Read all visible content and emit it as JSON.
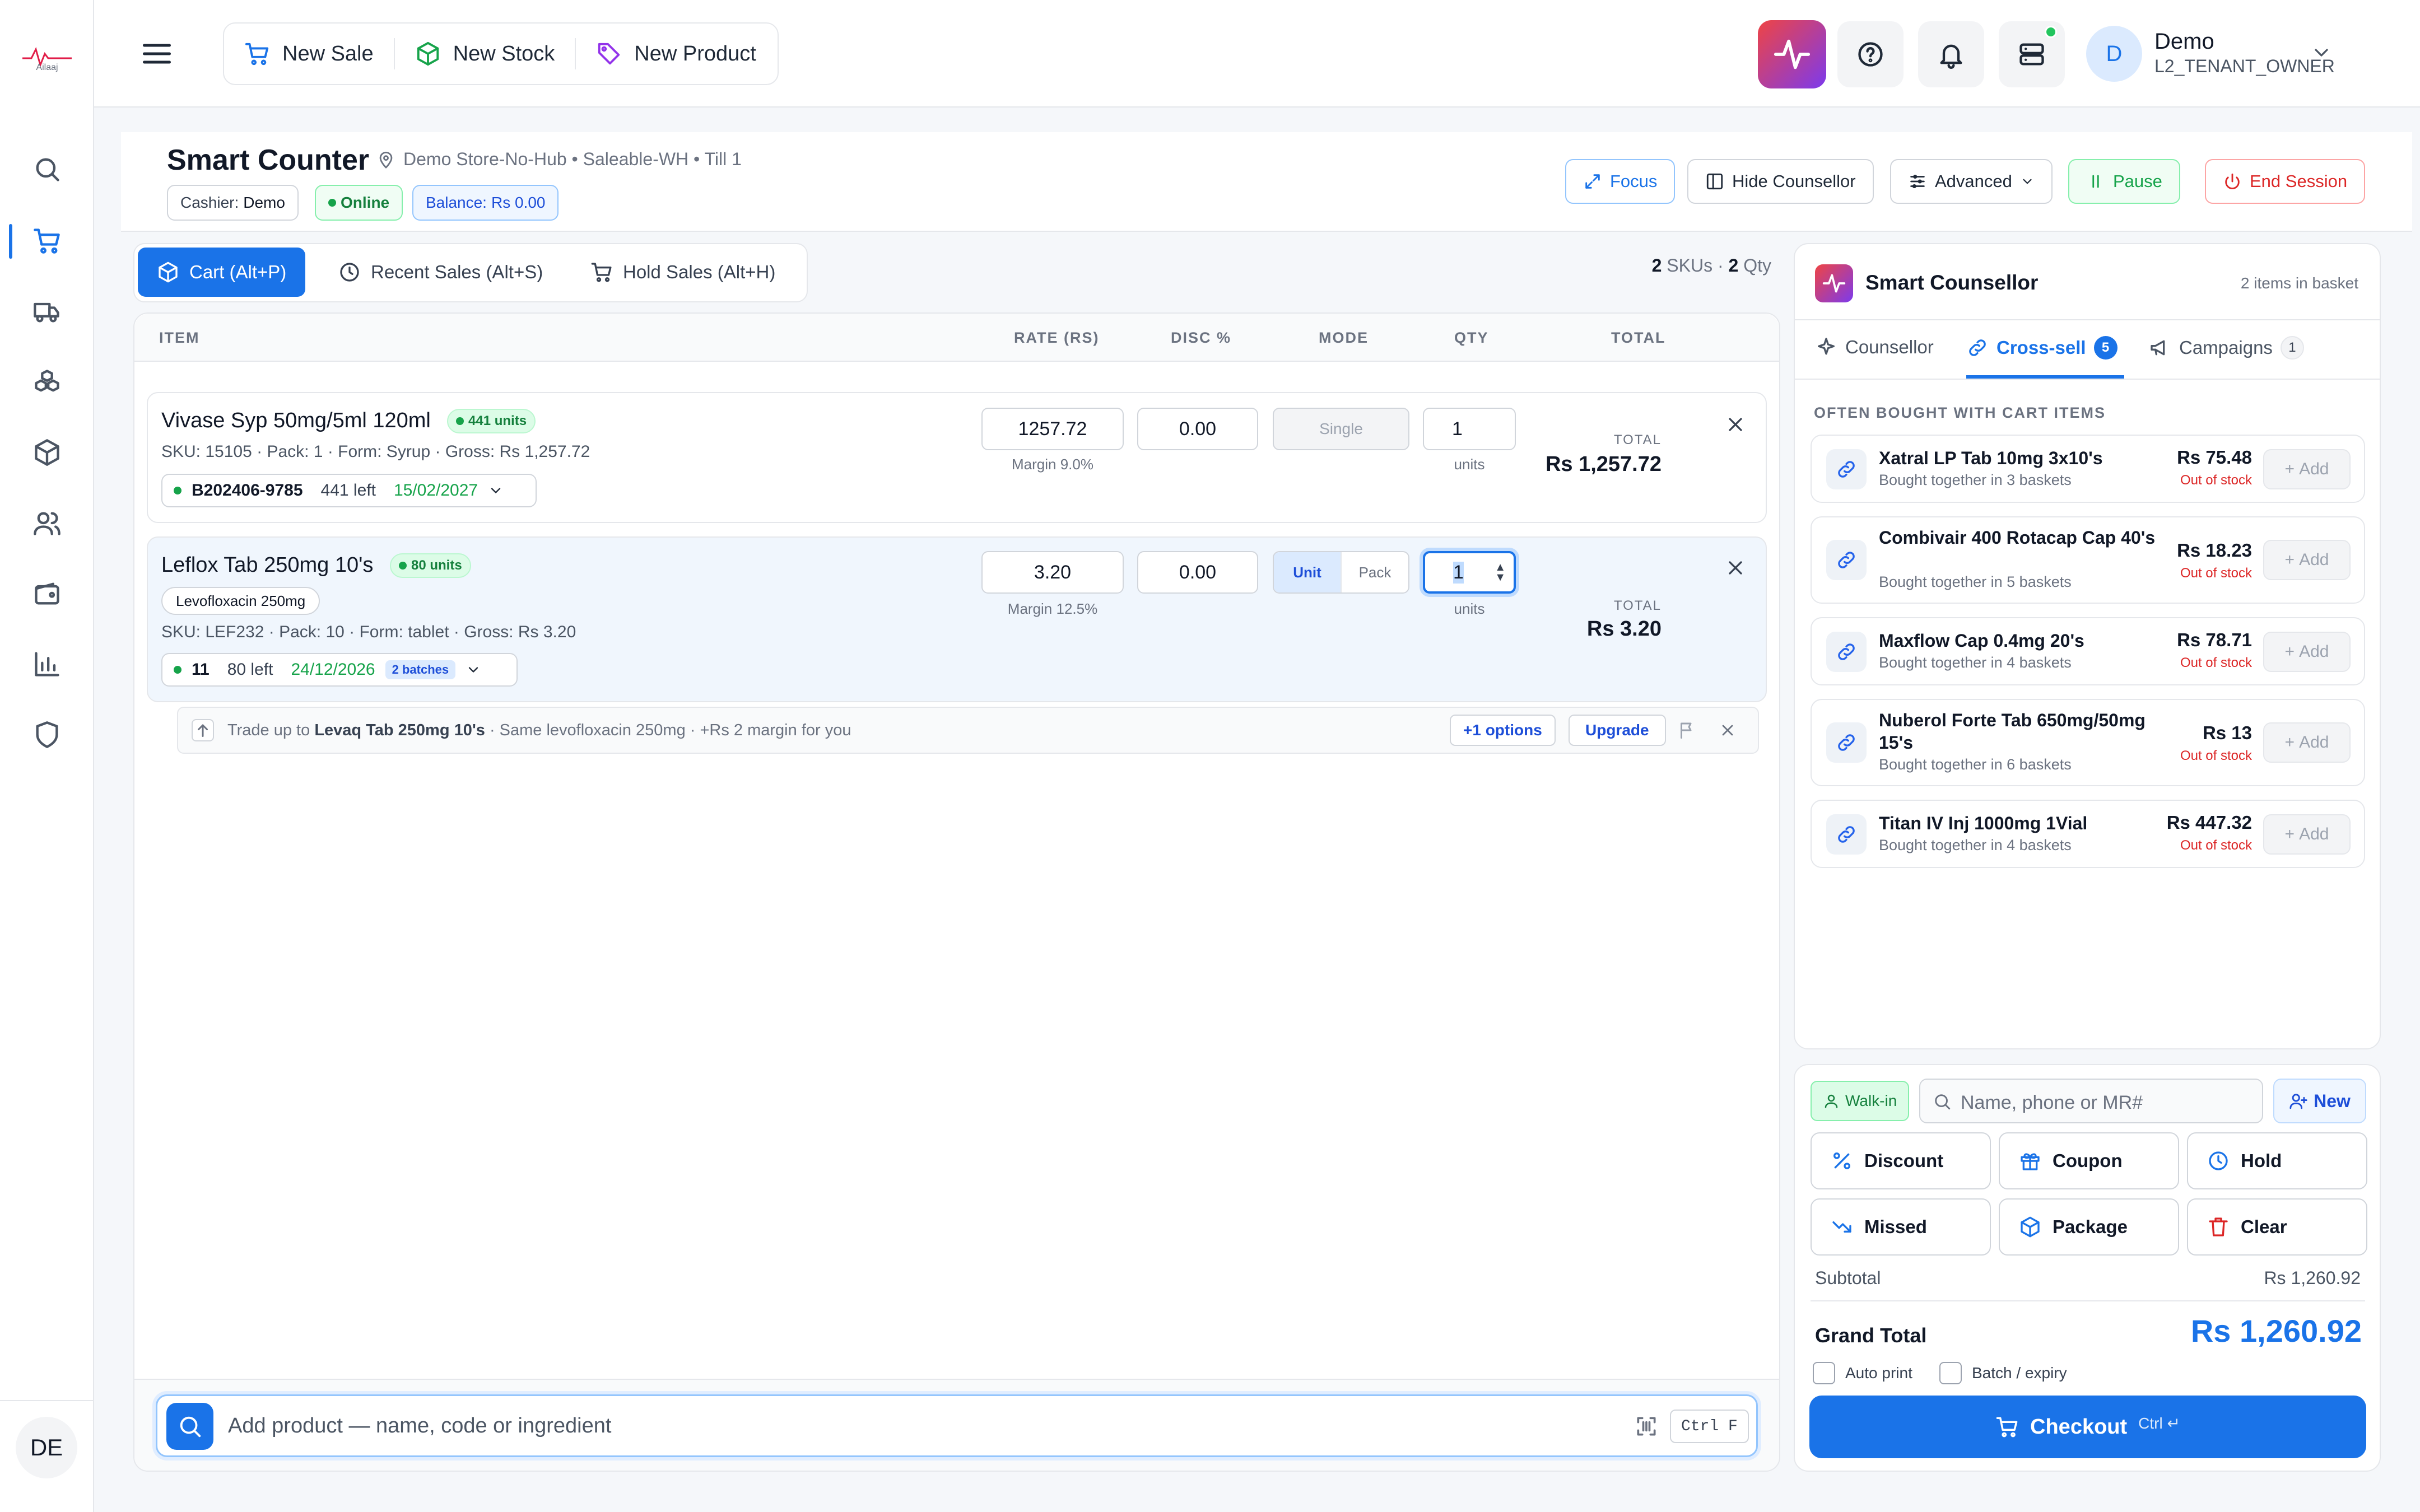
{
  "app": {
    "logo_text": "Ailaaj"
  },
  "user": {
    "avatar": "DE",
    "initial": "D",
    "name": "Demo",
    "role": "L2_TENANT_OWNER"
  },
  "quick_actions": [
    "New Sale",
    "New Stock",
    "New Product"
  ],
  "header": {
    "title": "Smart Counter",
    "location": "Demo Store-No-Hub • Saleable-WH • Till 1",
    "cashier_label": "Cashier:",
    "cashier": "Demo",
    "status": "Online",
    "balance_label": "Balance:",
    "balance": "Rs 0.00",
    "buttons": {
      "focus": "Focus",
      "hide": "Hide Counsellor",
      "advanced": "Advanced",
      "pause": "Pause",
      "end": "End Session"
    }
  },
  "tabs": [
    "Cart (Alt+P)",
    "Recent Sales (Alt+S)",
    "Hold Sales (Alt+H)"
  ],
  "summary": {
    "skus": "2",
    "skus_label": "SKUs ·",
    "qty": "2",
    "qty_label": "Qty"
  },
  "columns": [
    "ITEM",
    "RATE (RS)",
    "DISC %",
    "MODE",
    "QTY",
    "TOTAL"
  ],
  "cart": [
    {
      "name": "Vivase Syp 50mg/5ml 120ml",
      "stock_badge": "441 units",
      "meta": "SKU: 15105  ·  Pack: 1  ·  Form: Syrup  ·  Gross: Rs 1,257.72",
      "batch": "B202406-9785",
      "left": "441 left",
      "expiry": "15/02/2027",
      "rate": "1257.72",
      "margin": "Margin 9.0%",
      "disc": "0.00",
      "mode": "Single",
      "qty": "1",
      "units": "units",
      "total_label": "TOTAL",
      "total": "Rs 1,257.72"
    },
    {
      "name": "Leflox Tab 250mg 10's",
      "stock_badge": "80 units",
      "ingredient": "Levofloxacin 250mg",
      "meta": "SKU: LEF232  ·  Pack: 10  ·  Form: tablet  ·  Gross: Rs 3.20",
      "batch": "11",
      "left": "80 left",
      "expiry": "24/12/2026",
      "batches": "2 batches",
      "rate": "3.20",
      "margin": "Margin 12.5%",
      "disc": "0.00",
      "mode_a": "Unit",
      "mode_b": "Pack",
      "qty": "1",
      "units": "units",
      "total_label": "TOTAL",
      "total": "Rs 3.20"
    }
  ],
  "upsell": {
    "prefix": "Trade up to",
    "product": "Levaq Tab 250mg 10's",
    "suffix": "· Same levofloxacin 250mg · +Rs 2 margin for you",
    "options": "+1 options",
    "upgrade": "Upgrade"
  },
  "search": {
    "placeholder": "Add product — name, code or ingredient",
    "shortcut": "Ctrl F"
  },
  "counsellor": {
    "title": "Smart Counsellor",
    "basket": "2 items in basket",
    "tabs": [
      {
        "label": "Counsellor"
      },
      {
        "label": "Cross-sell",
        "count": "5"
      },
      {
        "label": "Campaigns",
        "count": "1"
      }
    ],
    "section": "OFTEN BOUGHT WITH CART ITEMS",
    "items": [
      {
        "name": "Xatral LP Tab 10mg 3x10's",
        "sub": "Bought together in 3 baskets",
        "price": "Rs 75.48",
        "status": "Out of stock",
        "add": "Add"
      },
      {
        "name": "Combivair 400 Rotacap Cap 40's",
        "sub": "Bought together in 5 baskets",
        "price": "Rs 18.23",
        "status": "Out of stock",
        "add": "Add"
      },
      {
        "name": "Maxflow Cap 0.4mg 20's",
        "sub": "Bought together in 4 baskets",
        "price": "Rs 78.71",
        "status": "Out of stock",
        "add": "Add"
      },
      {
        "name": "Nuberol Forte Tab 650mg/50mg 15's",
        "sub": "Bought together in 6 baskets",
        "price": "Rs 13",
        "status": "Out of stock",
        "add": "Add"
      },
      {
        "name": "Titan IV Inj 1000mg 1Vial",
        "sub": "Bought together in 4 baskets",
        "price": "Rs 447.32",
        "status": "Out of stock",
        "add": "Add"
      }
    ]
  },
  "checkout": {
    "walkin": "Walk-in",
    "customer_placeholder": "Name, phone or MR#",
    "new": "New",
    "actions": [
      "Discount",
      "Coupon",
      "Hold",
      "Missed",
      "Package",
      "Clear"
    ],
    "subtotal_label": "Subtotal",
    "subtotal": "Rs 1,260.92",
    "grand_label": "Grand Total",
    "grand": "Rs 1,260.92",
    "auto_print": "Auto print",
    "batch_expiry": "Batch / expiry",
    "button": "Checkout",
    "shortcut": "Ctrl ↵"
  },
  "colors": {
    "primary": "#1a73e8",
    "success": "#16a34a",
    "danger": "#dc2626",
    "brand_gradient": [
      "#ef4444",
      "#7c3aed"
    ]
  }
}
